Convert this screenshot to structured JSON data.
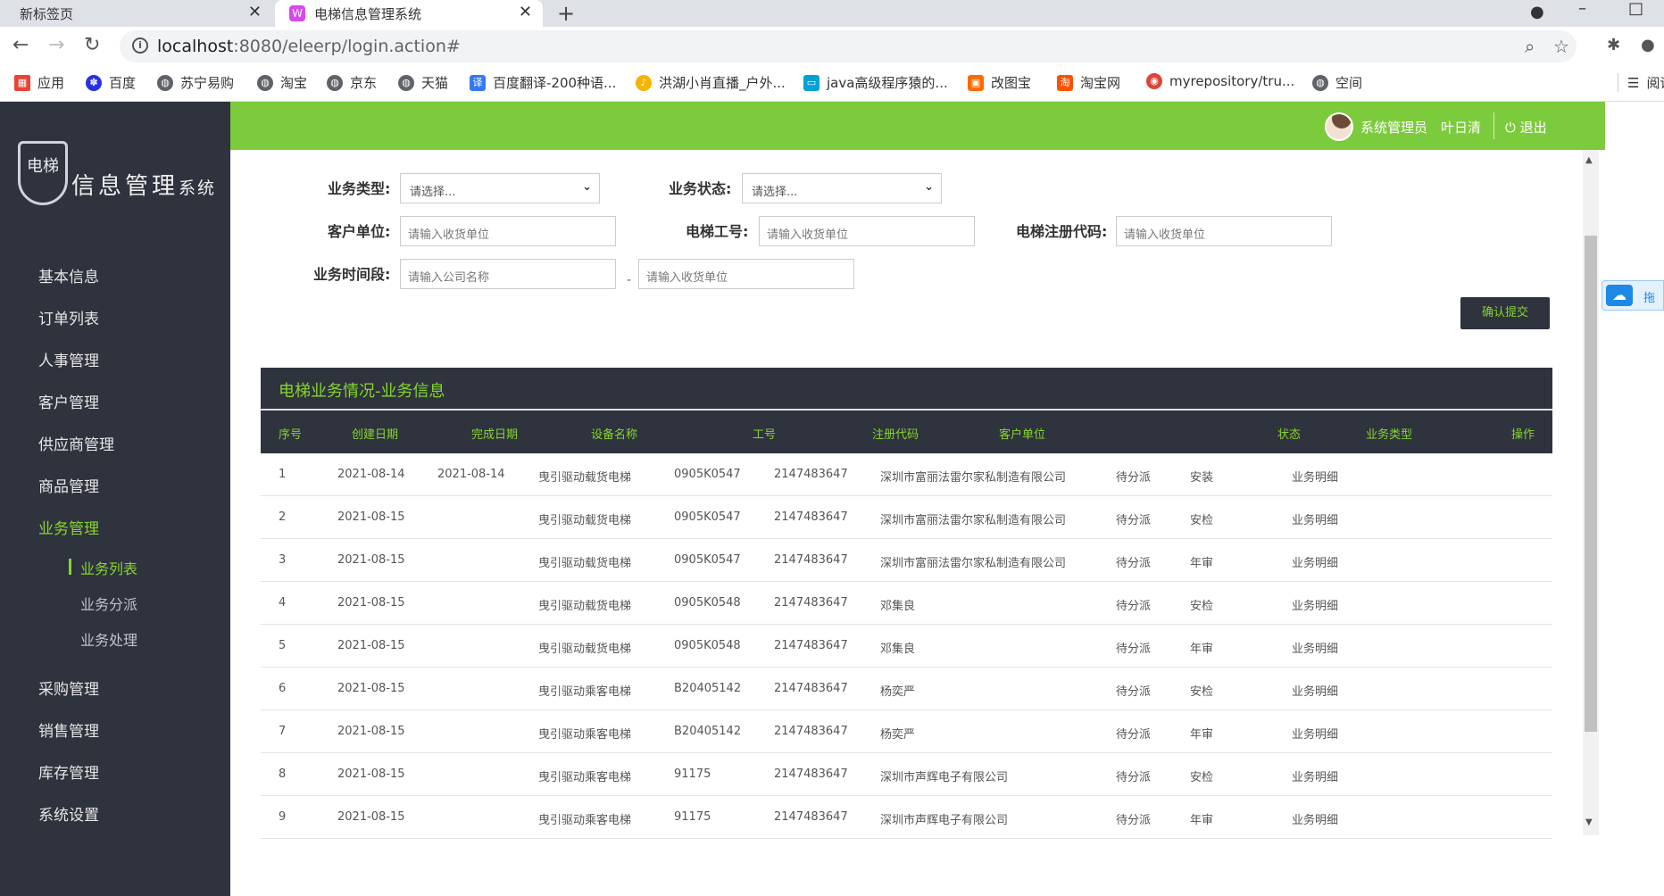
{
  "browser": {
    "tabs": [
      {
        "title": "新标签页"
      },
      {
        "title": "电梯信息管理系统"
      }
    ],
    "url_host": "localhost",
    "url_rest": ":8080/eleerp/login.action#",
    "bookmarks": [
      "应用",
      "百度",
      "苏宁易购",
      "淘宝",
      "京东",
      "天猫",
      "百度翻译-200种语...",
      "洪湖小肖直播_户外...",
      "java高级程序猿的...",
      "改图宝",
      "淘宝网",
      "myrepository/tru...",
      "空间",
      "阅读"
    ]
  },
  "logo": {
    "shield_text": "电梯",
    "title": "信息管理",
    "title_small": "系统"
  },
  "sidebar": {
    "items": [
      {
        "label": "基本信息"
      },
      {
        "label": "订单列表"
      },
      {
        "label": "人事管理"
      },
      {
        "label": "客户管理"
      },
      {
        "label": "供应商管理"
      },
      {
        "label": "商品管理"
      },
      {
        "label": "业务管理",
        "active": true
      },
      {
        "label": "采购管理"
      },
      {
        "label": "销售管理"
      },
      {
        "label": "库存管理"
      },
      {
        "label": "系统设置"
      }
    ],
    "sub_items": [
      {
        "label": "业务列表",
        "active": true
      },
      {
        "label": "业务分派"
      },
      {
        "label": "业务处理"
      }
    ]
  },
  "header": {
    "role": "系统管理员",
    "username": "叶日清",
    "logout": "退出"
  },
  "filters": {
    "biz_type_label": "业务类型:",
    "biz_type_value": "请选择...",
    "biz_status_label": "业务状态:",
    "biz_status_value": "请选择...",
    "customer_label": "客户单位:",
    "customer_placeholder": "请输入收货单位",
    "elevator_no_label": "电梯工号:",
    "elevator_no_placeholder": "请输入收货单位",
    "reg_code_label": "电梯注册代码:",
    "reg_code_placeholder": "请输入收货单位",
    "period_label": "业务时间段:",
    "period_start_placeholder": "请输入公司名称",
    "period_sep": "-",
    "period_end_placeholder": "请输入收货单位",
    "submit": "确认提交"
  },
  "table": {
    "title": "电梯业务情况-业务信息",
    "headers": [
      "序号",
      "创建日期",
      "完成日期",
      "设备名称",
      "工号",
      "注册代码",
      "客户单位",
      "状态",
      "业务类型",
      "操作"
    ],
    "rows": [
      [
        "1",
        "2021-08-14",
        "2021-08-14",
        "曳引驱动载货电梯",
        "0905K0547",
        "2147483647",
        "深圳市富丽法雷尔家私制造有限公司",
        "待分派",
        "安装",
        "业务明细"
      ],
      [
        "2",
        "2021-08-15",
        "",
        "曳引驱动载货电梯",
        "0905K0547",
        "2147483647",
        "深圳市富丽法雷尔家私制造有限公司",
        "待分派",
        "安检",
        "业务明细"
      ],
      [
        "3",
        "2021-08-15",
        "",
        "曳引驱动载货电梯",
        "0905K0547",
        "2147483647",
        "深圳市富丽法雷尔家私制造有限公司",
        "待分派",
        "年审",
        "业务明细"
      ],
      [
        "4",
        "2021-08-15",
        "",
        "曳引驱动载货电梯",
        "0905K0548",
        "2147483647",
        "邓集良",
        "待分派",
        "安检",
        "业务明细"
      ],
      [
        "5",
        "2021-08-15",
        "",
        "曳引驱动载货电梯",
        "0905K0548",
        "2147483647",
        "邓集良",
        "待分派",
        "年审",
        "业务明细"
      ],
      [
        "6",
        "2021-08-15",
        "",
        "曳引驱动乘客电梯",
        "B20405142",
        "2147483647",
        "杨奕严",
        "待分派",
        "安检",
        "业务明细"
      ],
      [
        "7",
        "2021-08-15",
        "",
        "曳引驱动乘客电梯",
        "B20405142",
        "2147483647",
        "杨奕严",
        "待分派",
        "年审",
        "业务明细"
      ],
      [
        "8",
        "2021-08-15",
        "",
        "曳引驱动乘客电梯",
        "91175",
        "2147483647",
        "深圳市声辉电子有限公司",
        "待分派",
        "安检",
        "业务明细"
      ],
      [
        "9",
        "2021-08-15",
        "",
        "曳引驱动乘客电梯",
        "91175",
        "2147483647",
        "深圳市声辉电子有限公司",
        "待分派",
        "年审",
        "业务明细"
      ]
    ]
  },
  "floating": {
    "label": "拖"
  },
  "colors": {
    "accent": "#86d52c",
    "header_green": "#7ccb3c",
    "sidebar": "#2f333e"
  }
}
